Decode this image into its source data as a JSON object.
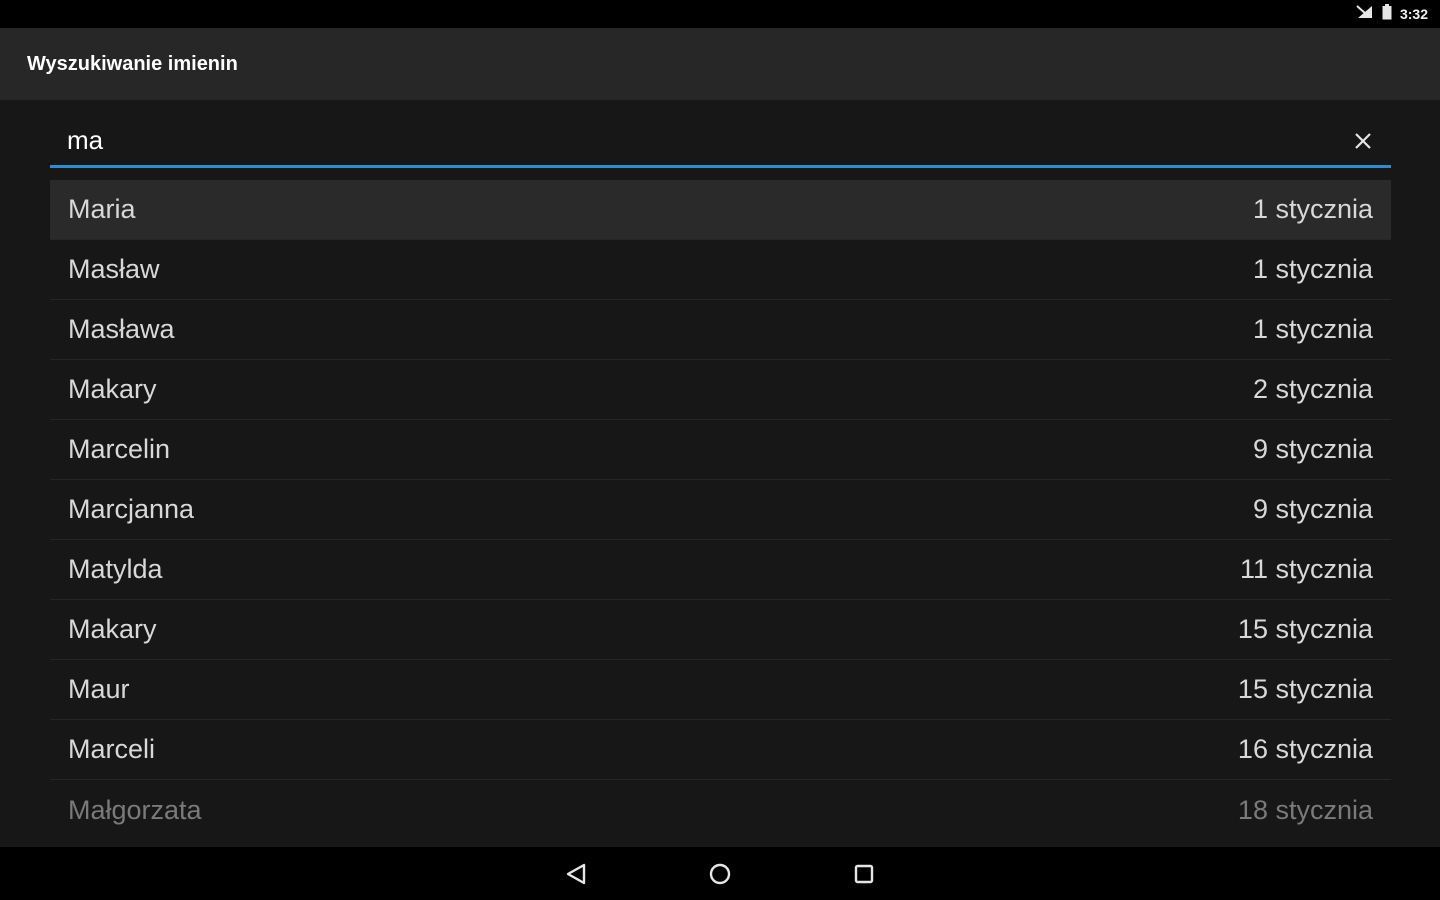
{
  "status_bar": {
    "time": "3:32",
    "icons": [
      "signal-icon",
      "battery-icon"
    ]
  },
  "app_bar": {
    "title": "Wyszukiwanie imienin"
  },
  "search": {
    "value": "ma",
    "clear_icon": "close-icon"
  },
  "results": [
    {
      "name": "Maria",
      "date": "1 stycznia"
    },
    {
      "name": "Masław",
      "date": "1 stycznia"
    },
    {
      "name": "Masława",
      "date": "1 stycznia"
    },
    {
      "name": "Makary",
      "date": "2 stycznia"
    },
    {
      "name": "Marcelin",
      "date": "9 stycznia"
    },
    {
      "name": "Marcjanna",
      "date": "9 stycznia"
    },
    {
      "name": "Matylda",
      "date": "11 stycznia"
    },
    {
      "name": "Makary",
      "date": "15 stycznia"
    },
    {
      "name": "Maur",
      "date": "15 stycznia"
    },
    {
      "name": "Marceli",
      "date": "16 stycznia"
    },
    {
      "name": "Małgorzata",
      "date": "18 stycznia"
    }
  ],
  "nav_bar": {
    "buttons": [
      "back-icon",
      "home-icon",
      "recents-icon"
    ]
  },
  "colors": {
    "accent": "#2a8fcc",
    "app_bar": "#272727",
    "background": "#171717"
  }
}
